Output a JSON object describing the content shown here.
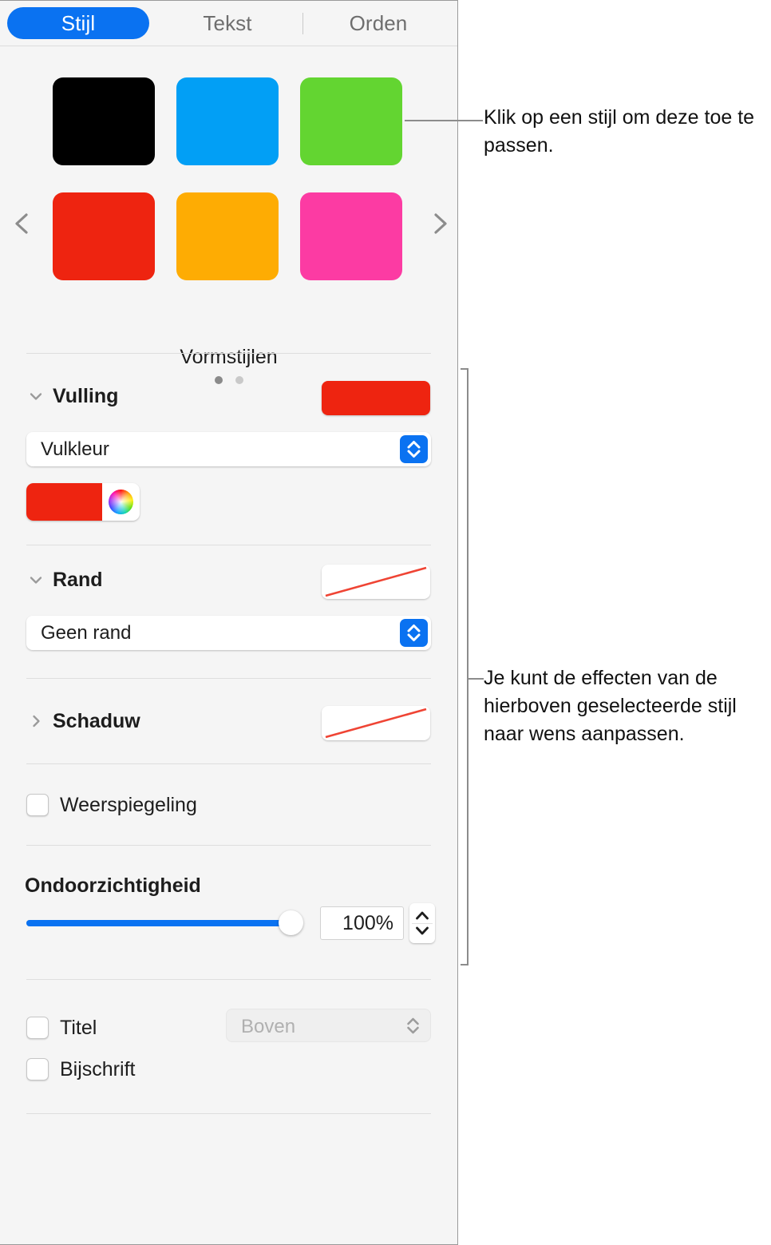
{
  "tabs": [
    {
      "label": "Stijl",
      "active": true
    },
    {
      "label": "Tekst",
      "active": false
    },
    {
      "label": "Orden",
      "active": false
    }
  ],
  "style_carousel": {
    "label": "Vormstijlen",
    "prev_icon": "chevron-left-icon",
    "next_icon": "chevron-right-icon",
    "swatches": [
      {
        "name": "black",
        "color": "#000000"
      },
      {
        "name": "blue",
        "color": "#029ff5"
      },
      {
        "name": "green",
        "color": "#63d531"
      },
      {
        "name": "red",
        "color": "#ee2410"
      },
      {
        "name": "orange",
        "color": "#feac03"
      },
      {
        "name": "pink",
        "color": "#fc3ba3"
      }
    ],
    "page_dots": [
      {
        "active": true
      },
      {
        "active": false
      }
    ]
  },
  "fill_section": {
    "title": "Vulling",
    "disclosure_icon": "chevron-down-icon",
    "expanded": true,
    "preview_color": "#ee2410",
    "popup_value": "Vulkleur",
    "color_well": {
      "color": "#ee2410",
      "wheel_icon": "color-wheel-icon"
    }
  },
  "border_section": {
    "title": "Rand",
    "disclosure_icon": "chevron-down-icon",
    "expanded": true,
    "preview_value": "none",
    "popup_value": "Geen rand"
  },
  "shadow_section": {
    "title": "Schaduw",
    "disclosure_icon": "chevron-right-icon",
    "expanded": false,
    "preview_value": "none"
  },
  "reflection": {
    "label": "Weerspiegeling",
    "checked": false
  },
  "opacity": {
    "label": "Ondoorzichtigheid",
    "value": "100%",
    "percent": 100,
    "accent_color": "#0a72f1",
    "stepper_icon": "stepper-up-down-icon"
  },
  "title_caption": {
    "title_label": "Titel",
    "title_checked": false,
    "caption_label": "Bijschrift",
    "caption_checked": false,
    "position_value": "Boven",
    "position_disabled": true
  },
  "callouts": [
    {
      "text": "Klik op een stijl om deze toe te passen."
    },
    {
      "text": "Je kunt de effecten van de hierboven geselecteerde stijl naar wens aanpassen."
    }
  ]
}
